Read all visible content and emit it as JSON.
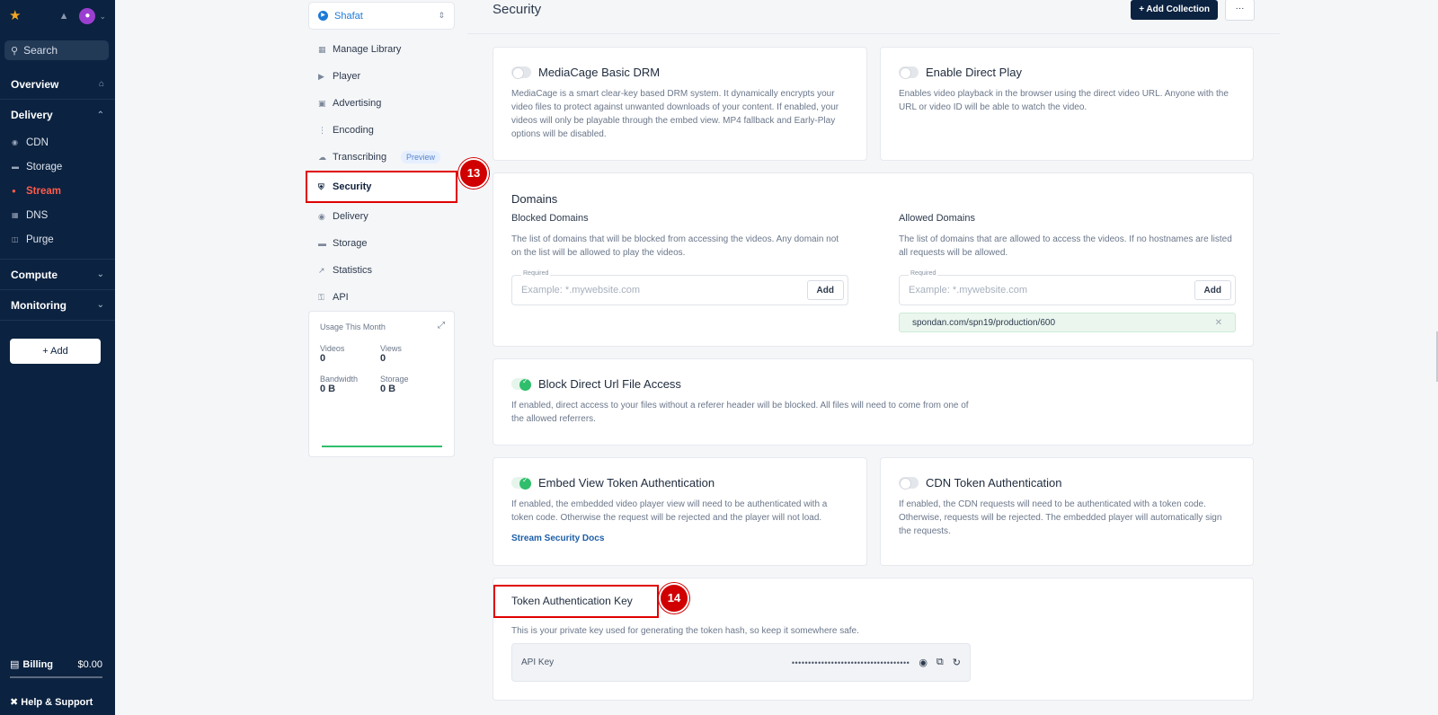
{
  "nav": {
    "search_label": "Search",
    "sections": {
      "overview": "Overview",
      "delivery": "Delivery",
      "compute": "Compute",
      "monitoring": "Monitoring"
    },
    "delivery_items": [
      "CDN",
      "Storage",
      "Stream",
      "DNS",
      "Purge"
    ],
    "add_label": "+ Add",
    "billing_label": "Billing",
    "billing_amount": "$0.00",
    "help_label": "Help & Support"
  },
  "subnav": {
    "library_name": "Shafat",
    "items": {
      "manage_library": "Manage Library",
      "player": "Player",
      "advertising": "Advertising",
      "encoding": "Encoding",
      "transcribing": "Transcribing",
      "transcribing_badge": "Preview",
      "security": "Security",
      "delivery": "Delivery",
      "storage": "Storage",
      "statistics": "Statistics",
      "api": "API"
    },
    "usage": {
      "title": "Usage This Month",
      "videos_label": "Videos",
      "videos_value": "0",
      "views_label": "Views",
      "views_value": "0",
      "bandwidth_label": "Bandwidth",
      "bandwidth_value": "0 B",
      "storage_label": "Storage",
      "storage_value": "0 B"
    }
  },
  "markers": {
    "m13": "13",
    "m14": "14"
  },
  "header": {
    "title": "Security",
    "add_collection": "+ Add Collection",
    "more": "···"
  },
  "drm": {
    "title": "MediaCage Basic DRM",
    "desc": "MediaCage is a smart clear-key based DRM system. It dynamically encrypts your video files to protect against unwanted downloads of your content. If enabled, your videos will only be playable through the embed view. MP4 fallback and Early-Play options will be disabled."
  },
  "direct_play": {
    "title": "Enable Direct Play",
    "desc": "Enables video playback in the browser using the direct video URL. Anyone with the URL or video ID will be able to watch the video."
  },
  "domains": {
    "title": "Domains",
    "blocked_title": "Blocked Domains",
    "blocked_desc": "The list of domains that will be blocked from accessing the videos. Any domain not on the list will be allowed to play the videos.",
    "allowed_title": "Allowed Domains",
    "allowed_desc": "The list of domains that are allowed to access the videos. If no hostnames are listed all requests will be allowed.",
    "required_label": "Required",
    "placeholder": "Example: *.mywebsite.com",
    "add_label": "Add",
    "allowed_entries": [
      "spondan.com/spn19/production/600"
    ]
  },
  "block_direct": {
    "title": "Block Direct Url File Access",
    "desc": "If enabled, direct access to your files without a referer header will be blocked. All files will need to come from one of the allowed referrers."
  },
  "embed_token": {
    "title": "Embed View Token Authentication",
    "desc": "If enabled, the embedded video player view will need to be authenticated with a token code. Otherwise the request will be rejected and the player will not load.",
    "link": "Stream Security Docs"
  },
  "cdn_token": {
    "title": "CDN Token Authentication",
    "desc": "If enabled, the CDN requests will need to be authenticated with a token code. Otherwise, requests will be rejected. The embedded player will automatically sign the requests."
  },
  "token_key": {
    "title": "Token Authentication Key",
    "desc": "This is your private key used for generating the token hash, so keep it somewhere safe.",
    "label": "API Key",
    "masked": "••••••••••••••••••••••••••••••••••••"
  },
  "colors": {
    "nav_bg": "#0b2240",
    "accent_red": "#ff5b4a",
    "toggle_on": "#2fbe6b",
    "highlight": "#e00000"
  }
}
